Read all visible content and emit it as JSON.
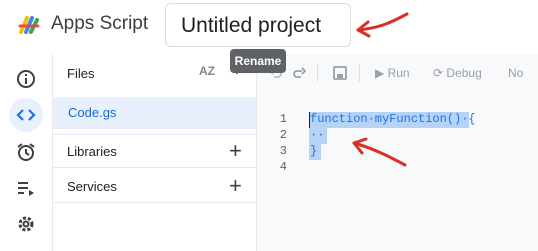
{
  "header": {
    "app_name": "Apps Script",
    "project_name": "Untitled project"
  },
  "tooltip": {
    "label": "Rename"
  },
  "rail": {
    "items": [
      {
        "icon": "info-icon"
      },
      {
        "icon": "code-icon",
        "active": true
      },
      {
        "icon": "alarm-icon"
      },
      {
        "icon": "executions-icon"
      },
      {
        "icon": "settings-icon"
      }
    ]
  },
  "files_panel": {
    "title": "Files",
    "sort_label": "AZ",
    "files": [
      {
        "name": "Code.gs"
      }
    ],
    "libraries_label": "Libraries",
    "services_label": "Services"
  },
  "toolbar": {
    "run_label": "Run",
    "debug_label": "Debug",
    "more_label": "No"
  },
  "editor": {
    "lines": [
      {
        "number": "1",
        "text": "function·myFunction()·{"
      },
      {
        "number": "2",
        "text": "··"
      },
      {
        "number": "3",
        "text": "}"
      },
      {
        "number": "4",
        "text": ""
      }
    ]
  },
  "colors": {
    "accent": "#1a73e8",
    "selection": "#b5d3f7",
    "annotation": "#d93025"
  }
}
